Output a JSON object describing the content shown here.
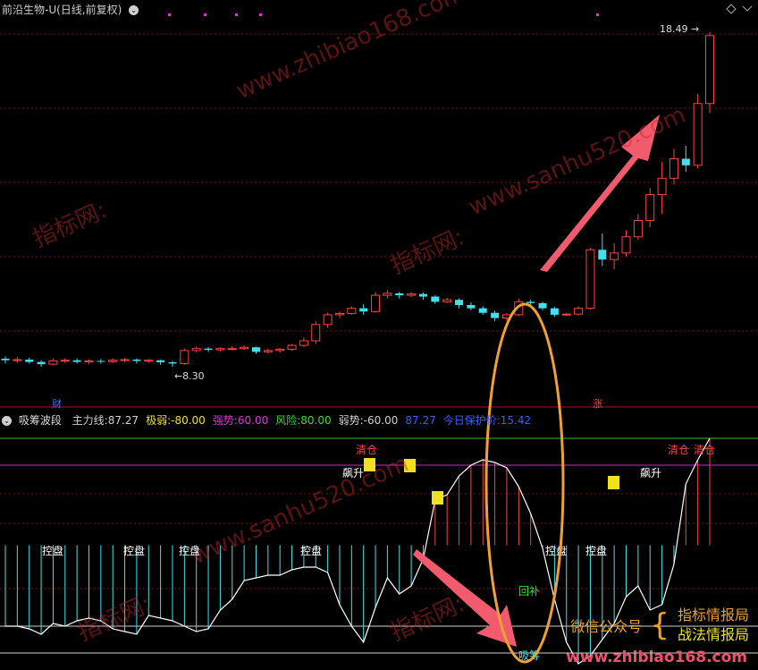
{
  "header": {
    "title": "前沿生物-U(日线,前复权)",
    "high_label": "18.49",
    "low_label": "8.30",
    "badge_cai": "财",
    "badge_zhang": "涨"
  },
  "indicator": {
    "name": "吸筹波段",
    "items": [
      {
        "label": "主力线:",
        "value": "87.27",
        "color": "#d0d0d0"
      },
      {
        "label": "极弱:",
        "value": "-80.00",
        "color": "#f0e020"
      },
      {
        "label": "强势:",
        "value": "60.00",
        "color": "#e030e0"
      },
      {
        "label": "风险:",
        "value": "80.00",
        "color": "#30e030"
      },
      {
        "label": "弱势:",
        "value": "-60.00",
        "color": "#d0d0d0"
      },
      {
        "label": "",
        "value": "87.27",
        "color": "#3060ff"
      },
      {
        "label": "今日保护价:",
        "value": "15.42",
        "color": "#3060ff"
      }
    ]
  },
  "signals": {
    "kongpan": "控盘",
    "piaosheng": "飙升",
    "qingcang": "清仓",
    "huibu": "回补",
    "xichou": "吸筹"
  },
  "wechat": {
    "label": "微信公众号",
    "items": [
      "指标情报局",
      "战法情报局"
    ],
    "site": "www.zhibiao168.com"
  },
  "watermarks": [
    "www.zhibiao168.com",
    "指标网:",
    "www.sanhu520.com"
  ],
  "colors": {
    "up": "#ff4040",
    "down": "#40e0f0",
    "bg": "#000000"
  },
  "chart_data": {
    "type": "candlestick",
    "candles": [
      [
        8.55,
        8.5,
        8.62,
        8.4
      ],
      [
        8.5,
        8.52,
        8.6,
        8.42
      ],
      [
        8.52,
        8.45,
        8.58,
        8.4
      ],
      [
        8.45,
        8.38,
        8.5,
        8.3
      ],
      [
        8.38,
        8.48,
        8.55,
        8.35
      ],
      [
        8.48,
        8.5,
        8.56,
        8.42
      ],
      [
        8.5,
        8.45,
        8.55,
        8.4
      ],
      [
        8.45,
        8.48,
        8.52,
        8.38
      ],
      [
        8.48,
        8.46,
        8.54,
        8.4
      ],
      [
        8.46,
        8.5,
        8.56,
        8.42
      ],
      [
        8.5,
        8.52,
        8.58,
        8.44
      ],
      [
        8.52,
        8.48,
        8.56,
        8.4
      ],
      [
        8.48,
        8.5,
        8.54,
        8.42
      ],
      [
        8.5,
        8.44,
        8.52,
        8.36
      ],
      [
        8.44,
        8.4,
        8.48,
        8.3
      ],
      [
        8.4,
        8.8,
        8.86,
        8.36
      ],
      [
        8.8,
        8.86,
        8.92,
        8.74
      ],
      [
        8.86,
        8.82,
        8.9,
        8.76
      ],
      [
        8.82,
        8.86,
        8.9,
        8.78
      ],
      [
        8.86,
        8.86,
        8.94,
        8.8
      ],
      [
        8.86,
        8.9,
        8.96,
        8.82
      ],
      [
        8.9,
        8.76,
        8.92,
        8.7
      ],
      [
        8.76,
        8.8,
        8.86,
        8.7
      ],
      [
        8.8,
        8.84,
        8.88,
        8.74
      ],
      [
        8.84,
        8.96,
        9.0,
        8.8
      ],
      [
        8.96,
        9.1,
        9.2,
        8.9
      ],
      [
        9.1,
        9.6,
        9.7,
        9.0
      ],
      [
        9.6,
        9.9,
        9.96,
        9.5
      ],
      [
        9.9,
        9.94,
        10.0,
        9.8
      ],
      [
        9.94,
        10.1,
        10.16,
        9.9
      ],
      [
        10.1,
        10.0,
        10.22,
        9.9
      ],
      [
        10.0,
        10.5,
        10.6,
        9.96
      ],
      [
        10.5,
        10.56,
        10.66,
        10.4
      ],
      [
        10.56,
        10.5,
        10.6,
        10.4
      ],
      [
        10.5,
        10.54,
        10.6,
        10.44
      ],
      [
        10.54,
        10.46,
        10.58,
        10.36
      ],
      [
        10.46,
        10.3,
        10.5,
        10.24
      ],
      [
        10.3,
        10.36,
        10.42,
        10.26
      ],
      [
        10.36,
        10.2,
        10.4,
        10.1
      ],
      [
        10.2,
        10.1,
        10.28,
        10.04
      ],
      [
        10.1,
        9.96,
        10.16,
        9.9
      ],
      [
        9.96,
        9.8,
        10.02,
        9.7
      ],
      [
        9.8,
        9.9,
        9.96,
        9.72
      ],
      [
        9.9,
        10.3,
        10.4,
        9.86
      ],
      [
        10.3,
        10.26,
        10.36,
        10.2
      ],
      [
        10.26,
        10.1,
        10.3,
        10.04
      ],
      [
        10.1,
        9.9,
        10.14,
        9.84
      ],
      [
        9.9,
        9.92,
        9.96,
        9.86
      ],
      [
        9.92,
        10.1,
        10.16,
        9.88
      ],
      [
        10.1,
        11.9,
        11.96,
        10.06
      ],
      [
        11.9,
        11.6,
        12.4,
        11.4
      ],
      [
        11.6,
        11.8,
        12.1,
        11.3
      ],
      [
        11.8,
        12.3,
        12.5,
        11.7
      ],
      [
        12.3,
        12.8,
        13.0,
        12.2
      ],
      [
        12.8,
        13.6,
        13.8,
        12.6
      ],
      [
        13.6,
        14.1,
        14.6,
        13.0
      ],
      [
        14.1,
        14.7,
        15.0,
        13.9
      ],
      [
        14.7,
        14.5,
        15.1,
        14.3
      ],
      [
        14.5,
        16.4,
        16.7,
        14.4
      ],
      [
        16.4,
        18.49,
        18.6,
        16.1
      ]
    ],
    "main_line": [
      -60,
      -60,
      -62,
      -66,
      -58,
      -60,
      -56,
      -54,
      -56,
      -62,
      -64,
      -66,
      -52,
      -54,
      -56,
      -60,
      -64,
      -62,
      -48,
      -40,
      -26,
      -24,
      -22,
      -22,
      -18,
      -16,
      -16,
      -20,
      -44,
      -60,
      -72,
      -46,
      -24,
      -36,
      -30,
      -10,
      34,
      38,
      52,
      60,
      64,
      62,
      58,
      44,
      24,
      -2,
      -40,
      -72,
      -88,
      -82,
      -70,
      -58,
      -38,
      -30,
      -48,
      -44,
      -14,
      46,
      64,
      80
    ],
    "ylim": [
      -90,
      90
    ]
  }
}
